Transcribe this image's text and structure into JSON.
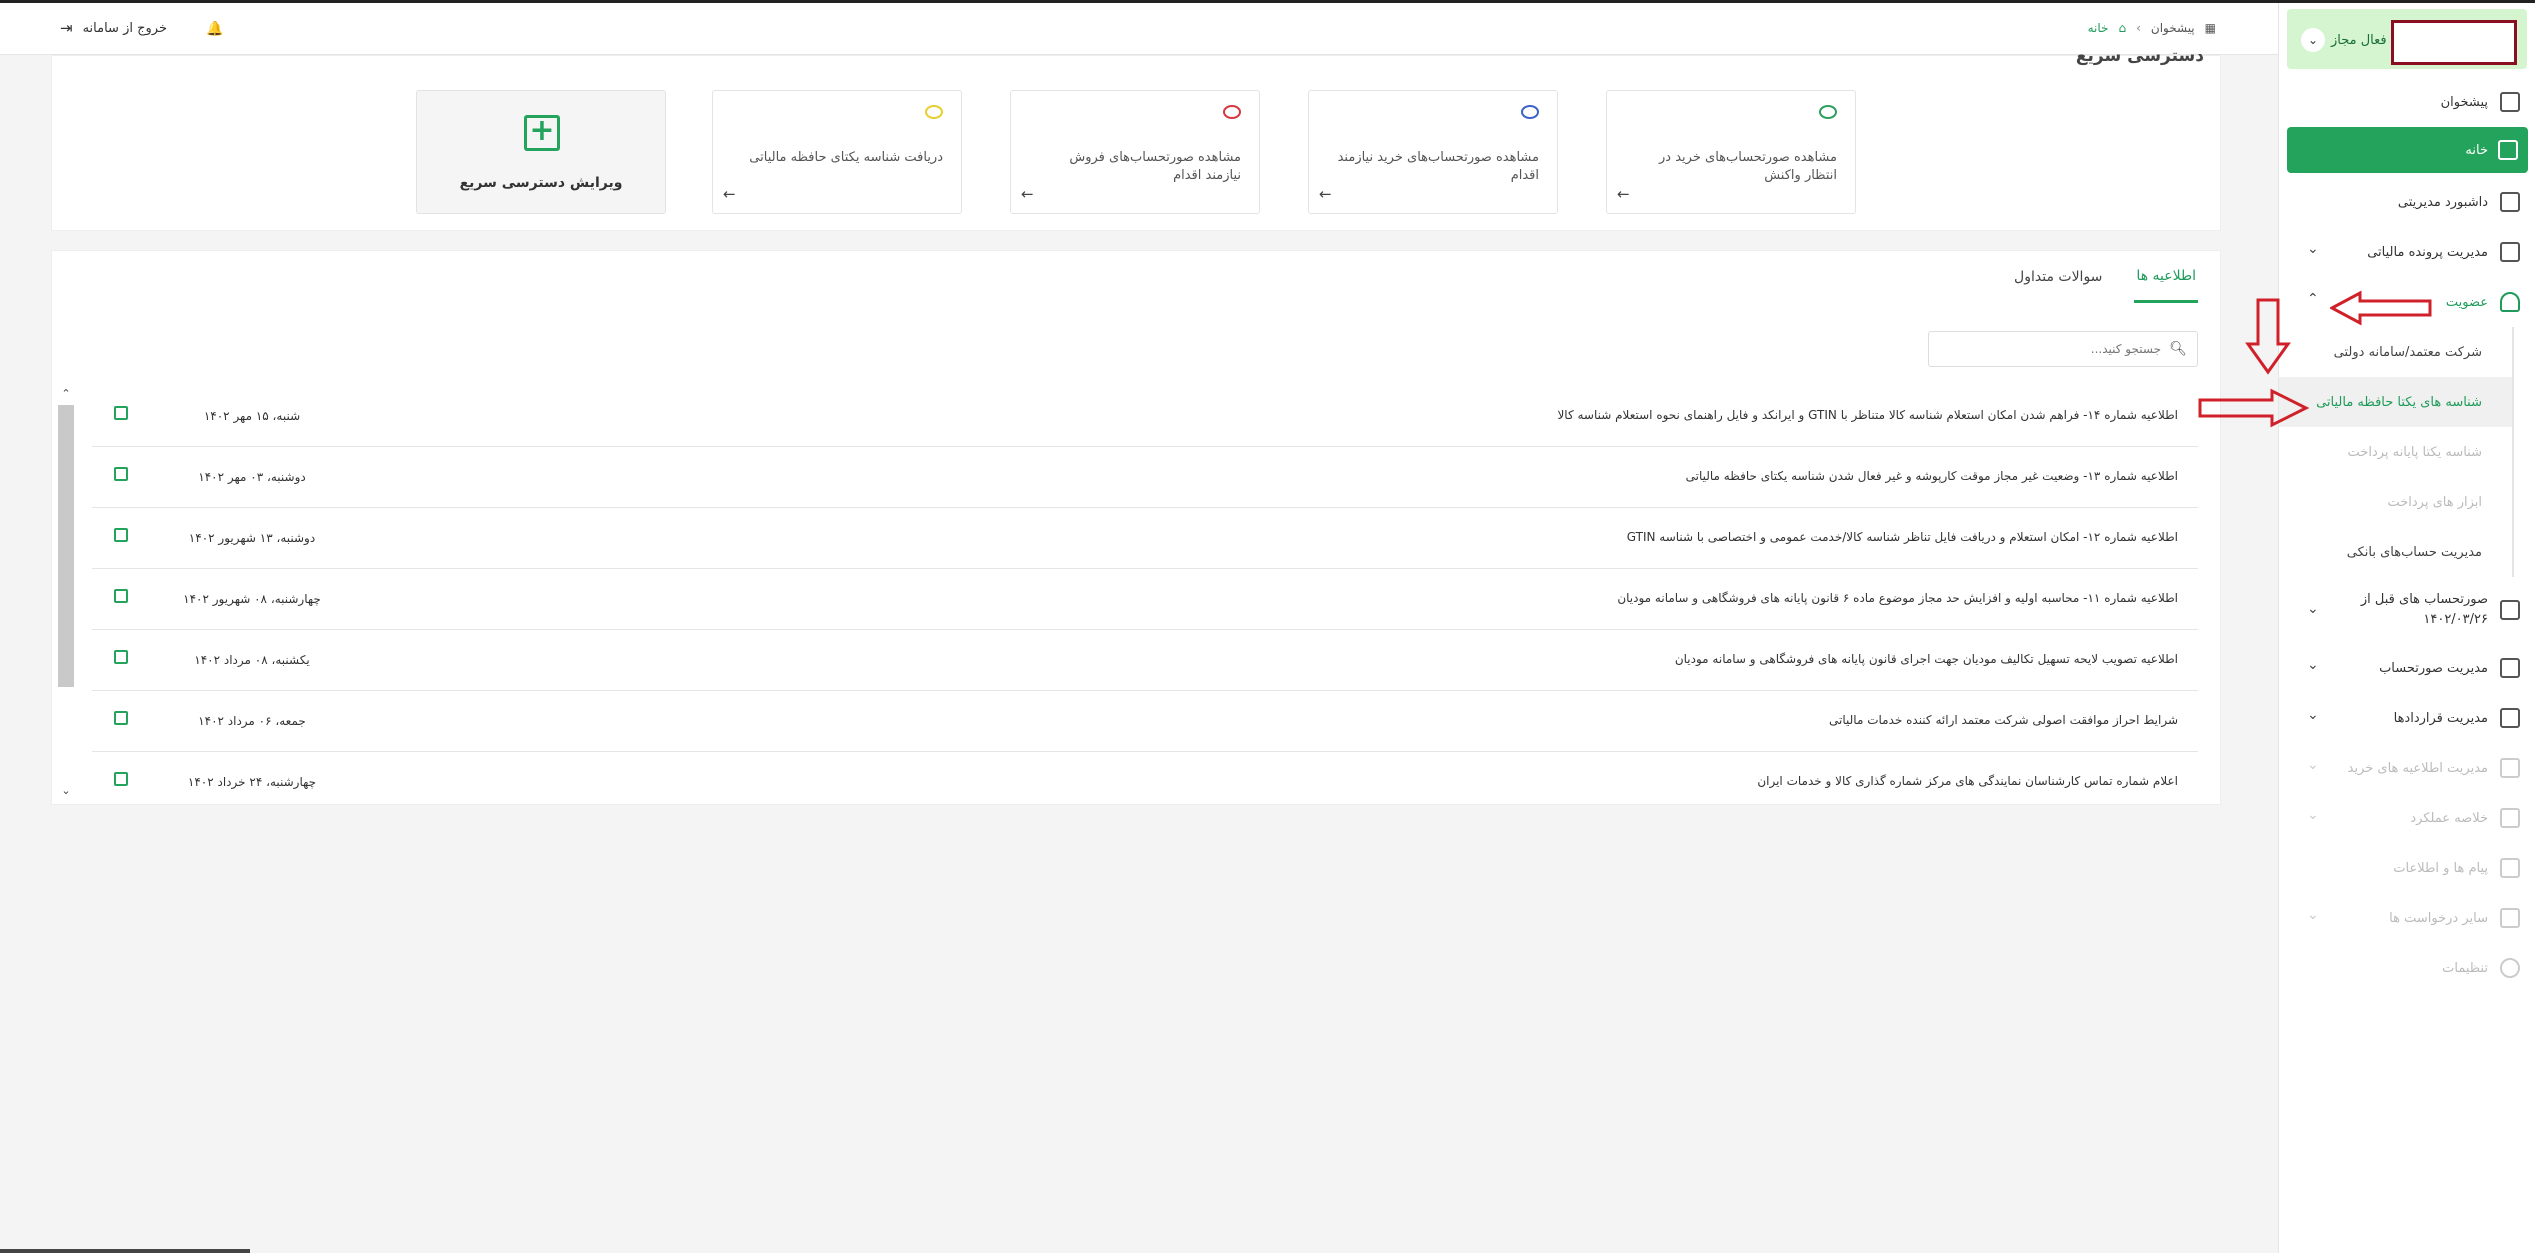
{
  "topbar": {
    "logout_label": "خروج از سامانه",
    "breadcrumb": [
      "پیشخوان",
      "خانه"
    ]
  },
  "sidebar": {
    "status": "فعال مجاز",
    "menu": {
      "dashboard_counter": "پیشخوان",
      "home": "خانه",
      "admin_dashboard": "داشبورد مدیریتی",
      "tax_file": "مدیریت پرونده مالیاتی",
      "membership": "عضویت",
      "sub_trusted_company": "شرکت معتمد/سامانه دولتی",
      "sub_unique_ids": "شناسه های یکتا حافظه مالیاتی",
      "sub_payment_terminal": "شناسه یکتا پایانه پرداخت",
      "sub_payment_tools": "ابزار های پرداخت",
      "sub_bank_accounts": "مدیریت حساب‌های بانکی",
      "invoices_before": "صورتحساب های قبل از ۱۴۰۲/۰۳/۲۶",
      "invoice_management": "مدیریت صورتحساب",
      "contract_management": "مدیریت قراردادها",
      "purchase_notices": "مدیریت اطلاعیه های خرید",
      "performance_summary": "خلاصه عملکرد",
      "messages": "پیام ها و اطلاعات",
      "other_requests": "سایر درخواست ها",
      "settings": "تنظیمات"
    }
  },
  "quick_access": {
    "title": "دسترسی سریع",
    "tiles": [
      {
        "label": "مشاهده صورتحساب‌های خرید در انتظار واکنش",
        "color": "#2e9e5e"
      },
      {
        "label": "مشاهده صورتحساب‌های خرید نیازمند اقدام",
        "color": "#3b63c9"
      },
      {
        "label": "مشاهده صورتحساب‌های فروش نیازمند اقدام",
        "color": "#d9363e"
      },
      {
        "label": "دریافت شناسه یکتای حافظه مالیاتی",
        "color": "#e6cf2e"
      }
    ],
    "edit_label": "ویرایش دسترسی سریع"
  },
  "notices": {
    "tabs": [
      "اطلاعیه ها",
      "سوالات متداول"
    ],
    "search_placeholder": "جستجو کنید...",
    "rows": [
      {
        "title": "اطلاعیه شماره ۱۴- فراهم شدن امکان استعلام شناسه کالا متناظر با GTIN و ایرانکد و فایل راهنمای نحوه استعلام شناسه کالا",
        "date": "شنبه، ۱۵ مهر ۱۴۰۲"
      },
      {
        "title": "اطلاعیه شماره ۱۳- وضعیت غیر مجاز موقت کارپوشه و غیر فعال شدن شناسه یکتای حافظه مالیاتی",
        "date": "دوشنبه، ۰۳ مهر ۱۴۰۲"
      },
      {
        "title": "اطلاعیه شماره ۱۲- امکان استعلام و دریافت فایل تناظر شناسه کالا/خدمت عمومی و اختصاصی با شناسه GTIN",
        "date": "دوشنبه، ۱۳ شهریور ۱۴۰۲"
      },
      {
        "title": "اطلاعیه شماره ۱۱- محاسبه اولیه و افزایش حد مجاز موضوع ماده ۶ قانون پایانه های فروشگاهی و سامانه مودیان",
        "date": "چهارشنبه، ۰۸ شهریور ۱۴۰۲"
      },
      {
        "title": "اطلاعیه تصویب لایحه تسهیل تکالیف مودیان جهت اجرای قانون پایانه های فروشگاهی و سامانه مودیان",
        "date": "یکشنبه، ۰۸ مرداد ۱۴۰۲"
      },
      {
        "title": "شرایط احراز موافقت اصولی شرکت معتمد ارائه کننده خدمات مالیاتی",
        "date": "جمعه، ۰۶ مرداد ۱۴۰۲"
      },
      {
        "title": "اعلام شماره تماس کارشناسان نمایندگی های مرکز شماره گذاری کالا و خدمات ایران",
        "date": "چهارشنبه، ۲۴ خرداد ۱۴۰۲"
      }
    ]
  },
  "colors": {
    "accent": "#23a35b",
    "annotation_red": "#d0202a"
  }
}
